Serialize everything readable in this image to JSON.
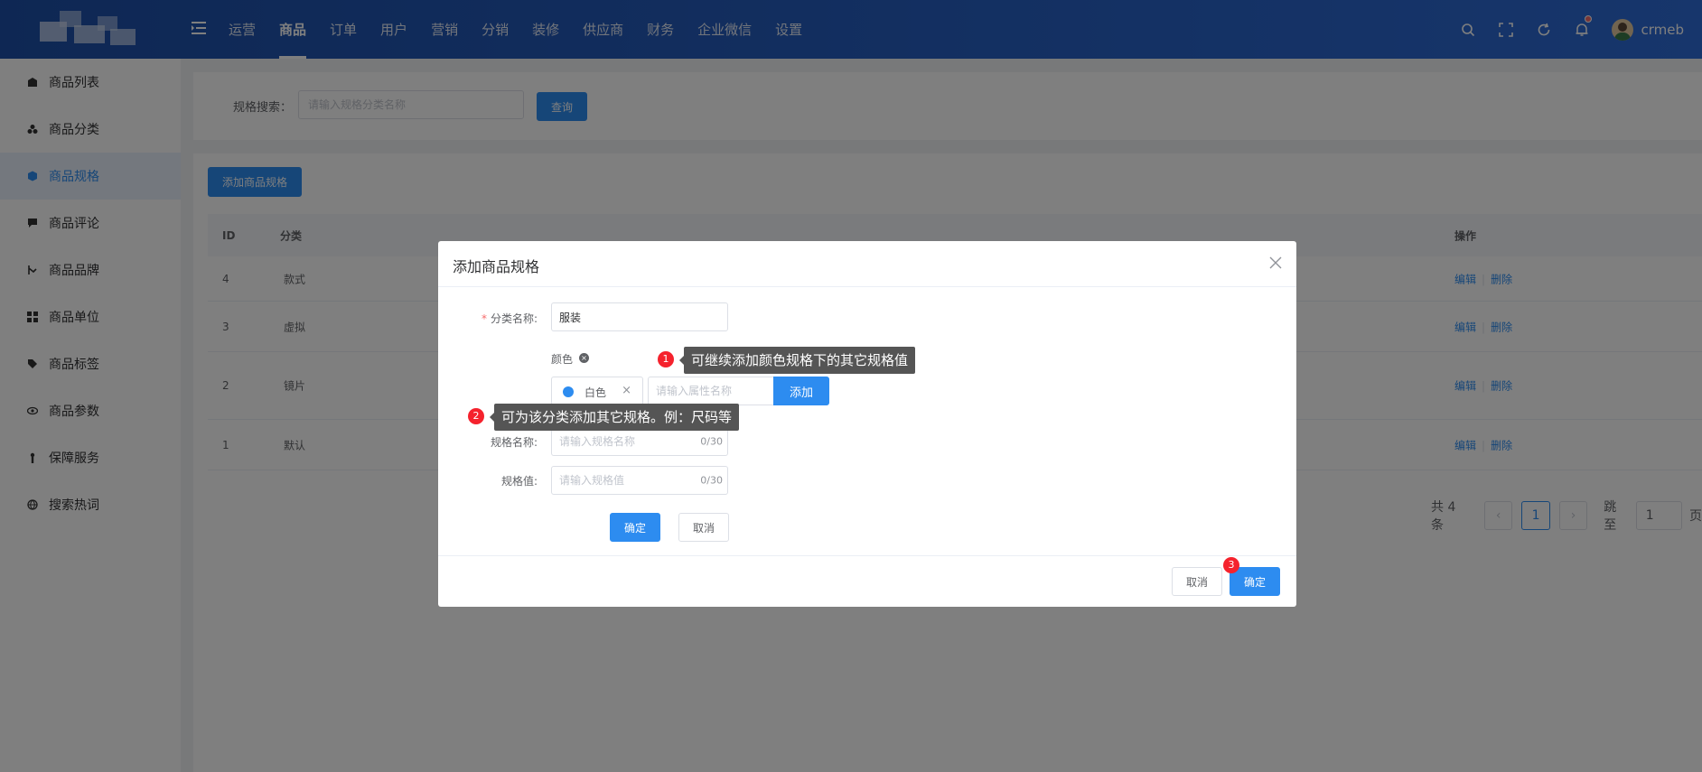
{
  "header": {
    "nav": [
      "运营",
      "商品",
      "订单",
      "用户",
      "营销",
      "分销",
      "装修",
      "供应商",
      "财务",
      "企业微信",
      "设置"
    ],
    "active_nav": "商品",
    "username": "crmeb"
  },
  "sidebar": {
    "items": [
      {
        "label": "商品列表",
        "icon": "shop-icon"
      },
      {
        "label": "商品分类",
        "icon": "category-icon"
      },
      {
        "label": "商品规格",
        "icon": "cube-icon",
        "active": true
      },
      {
        "label": "商品评论",
        "icon": "comment-icon"
      },
      {
        "label": "商品品牌",
        "icon": "brand-icon"
      },
      {
        "label": "商品单位",
        "icon": "grid-icon"
      },
      {
        "label": "商品标签",
        "icon": "tag-icon"
      },
      {
        "label": "商品参数",
        "icon": "eye-icon"
      },
      {
        "label": "保障服务",
        "icon": "service-icon"
      },
      {
        "label": "搜索热词",
        "icon": "hot-search-icon"
      }
    ]
  },
  "search": {
    "label": "规格搜索：",
    "placeholder": "请输入规格分类名称",
    "button": "查询"
  },
  "table": {
    "add_button": "添加商品规格",
    "columns": [
      "ID",
      "分类",
      "操作"
    ],
    "rows": [
      {
        "id": "4",
        "category": "款式"
      },
      {
        "id": "3",
        "category": "虚拟"
      },
      {
        "id": "2",
        "category": "镜片"
      },
      {
        "id": "1",
        "category": "默认"
      }
    ],
    "edit_label": "编辑",
    "delete_label": "删除"
  },
  "pagination": {
    "total": "共 4 条",
    "current": "1",
    "jump_label": "跳至",
    "jump_value": "1",
    "page_suffix": "页"
  },
  "dialog": {
    "title": "添加商品规格",
    "category_label": "分类名称:",
    "category_value": "服装",
    "spec_name": "颜色",
    "spec_value_tag": "白色",
    "attr_placeholder": "请输入属性名称",
    "add_button": "添加",
    "spec_name_label": "规格名称:",
    "spec_name_placeholder": "请输入规格名称",
    "spec_name_counter": "0/30",
    "spec_value_label": "规格值:",
    "spec_value_placeholder": "请输入规格值",
    "spec_value_counter": "0/30",
    "inner_confirm": "确定",
    "inner_cancel": "取消",
    "footer_cancel": "取消",
    "footer_ok": "确定"
  },
  "callouts": [
    {
      "num": "1",
      "text": "可继续添加颜色规格下的其它规格值"
    },
    {
      "num": "2",
      "text": "可为该分类添加其它规格。例：尺码等"
    },
    {
      "num": "3"
    }
  ],
  "colors": {
    "primary": "#2d8cf0",
    "header_gradient_start": "#1d4fa8",
    "header_gradient_end": "#2e6cd8",
    "badge": "#f5222d"
  }
}
